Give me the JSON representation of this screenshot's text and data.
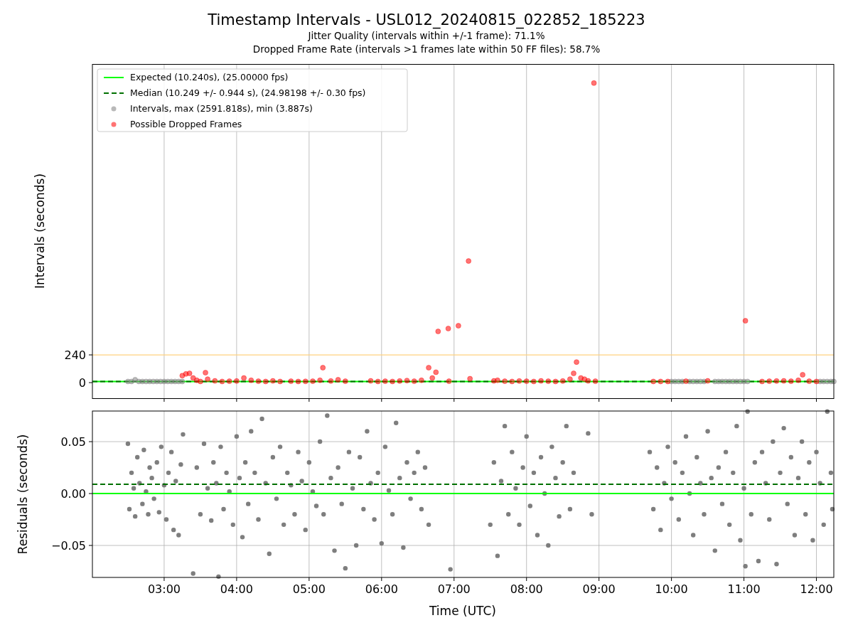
{
  "figure": {
    "title": "Timestamp Intervals - USL012_20240815_022852_185223",
    "subtitles": [
      "Jitter Quality (intervals within +/-1 frame): 71.1%",
      "Dropped Frame Rate (intervals >1 frames late within 50 FF files): 58.7%"
    ]
  },
  "intervals_chart": {
    "chart_data": {
      "type": "scatter",
      "ylabel": "Intervals (seconds)",
      "xlim": [
        2.01,
        12.24
      ],
      "ylim": [
        -135,
        2757
      ],
      "yticks": [
        {
          "value": 0,
          "label": "0"
        },
        {
          "value": 240,
          "label": "240"
        }
      ],
      "grid": true,
      "legend": "upper left",
      "ref_lines": [
        {
          "axis": "y",
          "value": 240,
          "color": "#ffd27f"
        },
        {
          "axis": "y",
          "value": 10.24,
          "color": "#00ff00",
          "label": "Expected (10.240s), (25.00000 fps)"
        },
        {
          "axis": "y",
          "value": 10.249,
          "color": "#007000",
          "label": "Median (10.249 +/- 0.944 s), (24.98198 +/- 0.30 fps)"
        }
      ],
      "series": [
        {
          "name": "Intervals, max (2591.818s), min (3.887s)",
          "color": "#808080",
          "x": [
            2.5,
            2.55,
            2.6,
            2.65,
            2.7,
            2.75,
            2.8,
            2.85,
            2.9,
            2.95,
            3.0,
            3.05,
            3.1,
            3.15,
            3.2,
            3.25,
            10.0,
            10.05,
            10.1,
            10.15,
            10.25,
            10.3,
            10.35,
            10.4,
            10.45,
            10.55,
            10.6,
            10.65,
            10.7,
            10.75,
            10.8,
            10.85,
            10.9,
            10.95,
            11.0,
            11.05,
            12.05,
            12.1,
            12.15,
            12.2,
            12.24
          ],
          "values": [
            10,
            10,
            25,
            10,
            10,
            10,
            10,
            10,
            10,
            10,
            10,
            10,
            10,
            10,
            10,
            10,
            10,
            10,
            10,
            10,
            10,
            10,
            10,
            10,
            10,
            null,
            10,
            10,
            10,
            10,
            10,
            10,
            10,
            10,
            10,
            10,
            10,
            10,
            10,
            10,
            10
          ]
        },
        {
          "name": "Possible Dropped Frames",
          "color": "#ff0000",
          "x": [
            3.25,
            3.3,
            3.35,
            3.4,
            3.45,
            3.5,
            3.57,
            3.6,
            3.7,
            3.8,
            3.9,
            4.0,
            4.1,
            4.2,
            4.3,
            4.4,
            4.5,
            4.6,
            4.75,
            4.85,
            4.95,
            5.05,
            5.15,
            5.19,
            5.3,
            5.4,
            5.5,
            5.85,
            5.95,
            6.05,
            6.15,
            6.25,
            6.35,
            6.45,
            6.55,
            6.65,
            6.7,
            6.75,
            6.78,
            6.92,
            6.93,
            7.06,
            7.2,
            7.22,
            7.55,
            7.6,
            7.7,
            7.8,
            7.9,
            8.0,
            8.1,
            8.2,
            8.3,
            8.4,
            8.5,
            8.6,
            8.65,
            8.69,
            8.75,
            8.8,
            8.85,
            8.93,
            8.95,
            9.75,
            9.85,
            9.95,
            10.2,
            10.5,
            11.02,
            11.25,
            11.35,
            11.45,
            11.55,
            11.65,
            11.75,
            11.81,
            11.9,
            12.0
          ],
          "values": [
            60,
            75,
            80,
            40,
            20,
            10,
            86,
            30,
            15,
            10,
            12,
            14,
            40,
            20,
            12,
            10,
            15,
            10,
            12,
            10,
            11,
            12,
            20,
            129,
            14,
            25,
            12,
            15,
            10,
            12,
            10,
            14,
            18,
            12,
            20,
            129,
            40,
            90,
            443,
            468,
            12,
            492,
            1052,
            34,
            15,
            20,
            12,
            10,
            14,
            12,
            10,
            15,
            12,
            10,
            14,
            30,
            80,
            178,
            40,
            30,
            15,
            2592,
            12,
            10,
            10,
            10,
            12,
            15,
            535,
            10,
            12,
            14,
            15,
            12,
            20,
            68,
            12,
            10
          ]
        }
      ]
    }
  },
  "residuals_chart": {
    "chart_data": {
      "type": "scatter",
      "xlabel": "Time (UTC)",
      "ylabel": "Residuals (seconds)",
      "xlim": [
        2.01,
        12.24
      ],
      "ylim": [
        -0.0808,
        0.0795
      ],
      "xticks": [
        {
          "value": 3,
          "label": "03:00"
        },
        {
          "value": 4,
          "label": "04:00"
        },
        {
          "value": 5,
          "label": "05:00"
        },
        {
          "value": 6,
          "label": "06:00"
        },
        {
          "value": 7,
          "label": "07:00"
        },
        {
          "value": 8,
          "label": "08:00"
        },
        {
          "value": 9,
          "label": "09:00"
        },
        {
          "value": 10,
          "label": "10:00"
        },
        {
          "value": 11,
          "label": "11:00"
        },
        {
          "value": 12,
          "label": "12:00"
        }
      ],
      "yticks": [
        {
          "value": -0.05,
          "label": "−0.05"
        },
        {
          "value": 0,
          "label": "0.00"
        },
        {
          "value": 0.05,
          "label": "0.05"
        }
      ],
      "grid": true,
      "ref_lines": [
        {
          "axis": "y",
          "value": 0,
          "color": "#00ff00"
        },
        {
          "axis": "y",
          "value": 0.009,
          "color": "#007000"
        }
      ],
      "series": [
        {
          "color": "#707070",
          "x": [
            2.5,
            2.52,
            2.55,
            2.58,
            2.6,
            2.63,
            2.66,
            2.7,
            2.72,
            2.75,
            2.78,
            2.8,
            2.83,
            2.86,
            2.9,
            2.93,
            2.96,
            3.0,
            3.03,
            3.06,
            3.1,
            3.13,
            3.16,
            3.2,
            3.23,
            3.26,
            3.4,
            3.45,
            3.5,
            3.55,
            3.6,
            3.65,
            3.68,
            3.72,
            3.75,
            3.78,
            3.82,
            3.86,
            3.9,
            3.95,
            4.0,
            4.04,
            4.08,
            4.12,
            4.16,
            4.2,
            4.25,
            4.3,
            4.35,
            4.4,
            4.45,
            4.5,
            4.55,
            4.6,
            4.65,
            4.7,
            4.75,
            4.8,
            4.85,
            4.9,
            4.95,
            5.0,
            5.05,
            5.1,
            5.15,
            5.2,
            5.25,
            5.3,
            5.35,
            5.4,
            5.45,
            5.5,
            5.55,
            5.6,
            5.65,
            5.7,
            5.75,
            5.8,
            5.85,
            5.9,
            5.95,
            6.0,
            6.05,
            6.1,
            6.15,
            6.2,
            6.25,
            6.3,
            6.35,
            6.4,
            6.45,
            6.5,
            6.55,
            6.6,
            6.65,
            6.95,
            7.5,
            7.55,
            7.6,
            7.65,
            7.7,
            7.75,
            7.8,
            7.85,
            7.9,
            7.95,
            8.0,
            8.05,
            8.1,
            8.15,
            8.2,
            8.25,
            8.3,
            8.35,
            8.4,
            8.45,
            8.5,
            8.55,
            8.6,
            8.65,
            8.85,
            8.9,
            9.7,
            9.75,
            9.8,
            9.85,
            9.9,
            9.95,
            10.0,
            10.05,
            10.1,
            10.15,
            10.2,
            10.25,
            10.3,
            10.35,
            10.4,
            10.45,
            10.5,
            10.55,
            10.6,
            10.65,
            10.7,
            10.75,
            10.8,
            10.85,
            10.9,
            10.95,
            11.0,
            11.02,
            11.05,
            11.1,
            11.15,
            11.2,
            11.25,
            11.3,
            11.35,
            11.4,
            11.45,
            11.5,
            11.55,
            11.6,
            11.65,
            11.7,
            11.75,
            11.8,
            11.85,
            11.9,
            11.95,
            12.0,
            12.05,
            12.1,
            12.15,
            12.2,
            12.22
          ],
          "values": [
            0.048,
            -0.015,
            0.02,
            0.005,
            -0.022,
            0.035,
            0.01,
            -0.01,
            0.042,
            0.002,
            -0.02,
            0.025,
            0.015,
            -0.005,
            0.03,
            -0.018,
            0.045,
            0.008,
            -0.025,
            0.02,
            0.04,
            -0.035,
            0.012,
            -0.04,
            0.028,
            0.057,
            -0.077,
            0.025,
            -0.02,
            0.048,
            0.005,
            -0.026,
            0.03,
            0.01,
            -0.08,
            0.045,
            -0.015,
            0.02,
            0.002,
            -0.03,
            0.055,
            0.015,
            -0.042,
            0.03,
            -0.01,
            0.06,
            0.02,
            -0.025,
            0.072,
            0.01,
            -0.058,
            0.035,
            -0.005,
            0.045,
            -0.03,
            0.02,
            0.008,
            -0.02,
            0.04,
            0.012,
            -0.035,
            0.03,
            0.002,
            -0.012,
            0.05,
            -0.02,
            0.075,
            0.015,
            -0.055,
            0.025,
            -0.01,
            -0.072,
            0.04,
            0.005,
            -0.05,
            0.035,
            -0.015,
            0.06,
            0.01,
            -0.025,
            0.02,
            -0.048,
            0.045,
            0.003,
            -0.02,
            0.068,
            0.015,
            -0.052,
            0.03,
            -0.005,
            0.02,
            0.04,
            -0.015,
            0.025,
            -0.03,
            -0.073,
            -0.03,
            0.03,
            -0.06,
            0.012,
            0.065,
            -0.02,
            0.04,
            0.005,
            -0.03,
            0.025,
            0.055,
            -0.012,
            0.02,
            -0.04,
            0.035,
            0.0,
            -0.05,
            0.045,
            0.015,
            -0.022,
            0.03,
            0.065,
            -0.015,
            0.02,
            0.058,
            -0.02,
            0.04,
            -0.015,
            0.025,
            -0.035,
            0.01,
            0.045,
            -0.005,
            0.03,
            -0.025,
            0.02,
            0.055,
            0.0,
            -0.04,
            0.035,
            0.01,
            -0.02,
            0.06,
            0.015,
            -0.055,
            0.025,
            -0.01,
            0.04,
            -0.03,
            0.02,
            0.065,
            -0.045,
            0.005,
            -0.07,
            0.079,
            -0.02,
            0.03,
            -0.065,
            0.04,
            0.01,
            -0.025,
            0.05,
            -0.068,
            0.02,
            0.063,
            -0.01,
            0.035,
            -0.04,
            0.015,
            0.05,
            -0.02,
            0.03,
            -0.045,
            0.04,
            0.01,
            -0.03,
            0.079,
            0.02,
            -0.015
          ]
        }
      ]
    }
  }
}
